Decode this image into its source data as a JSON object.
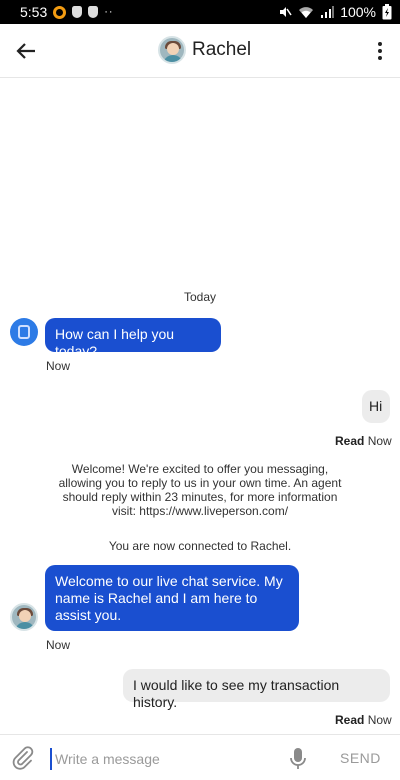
{
  "status_bar": {
    "time": "5:53",
    "dots": "··",
    "battery_percent": "100%"
  },
  "header": {
    "title": "Rachel"
  },
  "conversation": {
    "date_label": "Today",
    "messages": [
      {
        "from": "agent",
        "text": "How can I help you today?",
        "time": "Now"
      },
      {
        "from": "user",
        "text": "Hi",
        "status": "Read",
        "time": "Now"
      },
      {
        "from": "system",
        "text": "Welcome! We're excited to offer you messaging, allowing you to reply to us in your own time. An agent should reply within 23 minutes, for more information visit: https://www.liveperson.com/"
      },
      {
        "from": "system",
        "text": "You are now connected to Rachel."
      },
      {
        "from": "agent",
        "text": "Welcome to our live chat service. My name is Rachel and I am here to assist you.",
        "time": "Now"
      },
      {
        "from": "user",
        "text": "I would like to see my transaction history.",
        "status": "Read",
        "time": "Now"
      }
    ]
  },
  "composer": {
    "placeholder": "Write a message",
    "send_label": "SEND"
  },
  "colors": {
    "agent_bubble": "#1a4fd0",
    "user_bubble": "#ececec",
    "avatar_blue": "#2d7be6"
  }
}
